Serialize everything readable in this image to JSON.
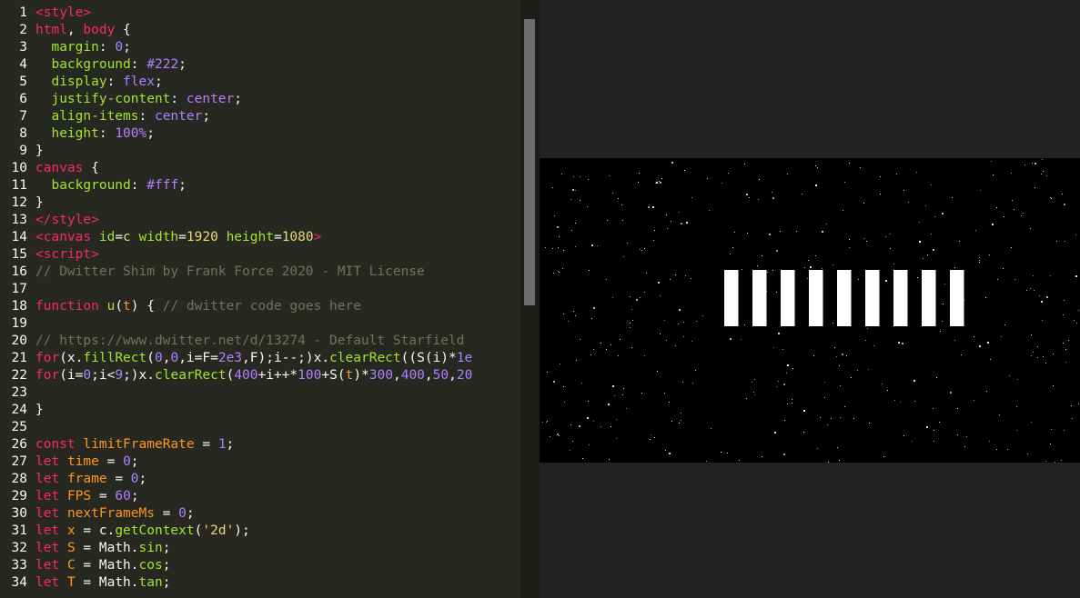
{
  "editor": {
    "lines": [
      {
        "n": "1",
        "t": [
          {
            "c": "t-tag",
            "s": "<style>"
          }
        ]
      },
      {
        "n": "2",
        "t": [
          {
            "c": "t-tag",
            "s": "html"
          },
          {
            "c": "t-plain",
            "s": ", "
          },
          {
            "c": "t-tag",
            "s": "body"
          },
          {
            "c": "t-plain",
            "s": " {"
          }
        ]
      },
      {
        "n": "3",
        "t": [
          {
            "c": "t-plain",
            "s": "  "
          },
          {
            "c": "t-prop",
            "s": "margin"
          },
          {
            "c": "t-plain",
            "s": ": "
          },
          {
            "c": "t-num",
            "s": "0"
          },
          {
            "c": "t-plain",
            "s": ";"
          }
        ]
      },
      {
        "n": "4",
        "t": [
          {
            "c": "t-plain",
            "s": "  "
          },
          {
            "c": "t-prop",
            "s": "background"
          },
          {
            "c": "t-plain",
            "s": ": "
          },
          {
            "c": "t-num",
            "s": "#222"
          },
          {
            "c": "t-plain",
            "s": ";"
          }
        ]
      },
      {
        "n": "5",
        "t": [
          {
            "c": "t-plain",
            "s": "  "
          },
          {
            "c": "t-prop",
            "s": "display"
          },
          {
            "c": "t-plain",
            "s": ": "
          },
          {
            "c": "t-num",
            "s": "flex"
          },
          {
            "c": "t-plain",
            "s": ";"
          }
        ]
      },
      {
        "n": "6",
        "t": [
          {
            "c": "t-plain",
            "s": "  "
          },
          {
            "c": "t-prop",
            "s": "justify-content"
          },
          {
            "c": "t-plain",
            "s": ": "
          },
          {
            "c": "t-num",
            "s": "center"
          },
          {
            "c": "t-plain",
            "s": ";"
          }
        ]
      },
      {
        "n": "7",
        "t": [
          {
            "c": "t-plain",
            "s": "  "
          },
          {
            "c": "t-prop",
            "s": "align-items"
          },
          {
            "c": "t-plain",
            "s": ": "
          },
          {
            "c": "t-num",
            "s": "center"
          },
          {
            "c": "t-plain",
            "s": ";"
          }
        ]
      },
      {
        "n": "8",
        "t": [
          {
            "c": "t-plain",
            "s": "  "
          },
          {
            "c": "t-prop",
            "s": "height"
          },
          {
            "c": "t-plain",
            "s": ": "
          },
          {
            "c": "t-num",
            "s": "100%"
          },
          {
            "c": "t-plain",
            "s": ";"
          }
        ]
      },
      {
        "n": "9",
        "t": [
          {
            "c": "t-plain",
            "s": "}"
          }
        ]
      },
      {
        "n": "10",
        "t": [
          {
            "c": "t-tag",
            "s": "canvas"
          },
          {
            "c": "t-plain",
            "s": " {"
          }
        ]
      },
      {
        "n": "11",
        "t": [
          {
            "c": "t-plain",
            "s": "  "
          },
          {
            "c": "t-prop",
            "s": "background"
          },
          {
            "c": "t-plain",
            "s": ": "
          },
          {
            "c": "t-num",
            "s": "#fff"
          },
          {
            "c": "t-plain",
            "s": ";"
          }
        ]
      },
      {
        "n": "12",
        "t": [
          {
            "c": "t-plain",
            "s": "}"
          }
        ]
      },
      {
        "n": "13",
        "t": [
          {
            "c": "t-tag",
            "s": "</style>"
          }
        ]
      },
      {
        "n": "14",
        "t": [
          {
            "c": "t-tag",
            "s": "<canvas "
          },
          {
            "c": "t-prop",
            "s": "id"
          },
          {
            "c": "t-plain",
            "s": "="
          },
          {
            "c": "t-str",
            "s": "c"
          },
          {
            "c": "t-plain",
            "s": " "
          },
          {
            "c": "t-prop",
            "s": "width"
          },
          {
            "c": "t-plain",
            "s": "="
          },
          {
            "c": "t-str",
            "s": "1920"
          },
          {
            "c": "t-plain",
            "s": " "
          },
          {
            "c": "t-prop",
            "s": "height"
          },
          {
            "c": "t-plain",
            "s": "="
          },
          {
            "c": "t-str",
            "s": "1080"
          },
          {
            "c": "t-tag",
            "s": ">"
          }
        ]
      },
      {
        "n": "15",
        "t": [
          {
            "c": "t-tag",
            "s": "<script>"
          }
        ]
      },
      {
        "n": "16",
        "t": [
          {
            "c": "t-com",
            "s": "// Dwitter Shim by Frank Force 2020 - MIT License"
          }
        ]
      },
      {
        "n": "17",
        "t": []
      },
      {
        "n": "18",
        "t": [
          {
            "c": "t-kw",
            "s": "function"
          },
          {
            "c": "t-plain",
            "s": " "
          },
          {
            "c": "t-fn",
            "s": "u"
          },
          {
            "c": "t-plain",
            "s": "("
          },
          {
            "c": "t-var",
            "s": "t"
          },
          {
            "c": "t-plain",
            "s": ") { "
          },
          {
            "c": "t-com",
            "s": "// dwitter code goes here"
          }
        ]
      },
      {
        "n": "19",
        "t": []
      },
      {
        "n": "20",
        "t": [
          {
            "c": "t-com",
            "s": "// https://www.dwitter.net/d/13274 - Default Starfield"
          }
        ]
      },
      {
        "n": "21",
        "t": [
          {
            "c": "t-kw",
            "s": "for"
          },
          {
            "c": "t-plain",
            "s": "(x."
          },
          {
            "c": "t-fn",
            "s": "fillRect"
          },
          {
            "c": "t-plain",
            "s": "("
          },
          {
            "c": "t-num",
            "s": "0"
          },
          {
            "c": "t-plain",
            "s": ","
          },
          {
            "c": "t-num",
            "s": "0"
          },
          {
            "c": "t-plain",
            "s": ",i=F="
          },
          {
            "c": "t-num",
            "s": "2e3"
          },
          {
            "c": "t-plain",
            "s": ",F);i--;)x."
          },
          {
            "c": "t-fn",
            "s": "clearRect"
          },
          {
            "c": "t-plain",
            "s": "((S(i)*"
          },
          {
            "c": "t-num",
            "s": "1e"
          }
        ]
      },
      {
        "n": "22",
        "t": [
          {
            "c": "t-kw",
            "s": "for"
          },
          {
            "c": "t-plain",
            "s": "(i="
          },
          {
            "c": "t-num",
            "s": "0"
          },
          {
            "c": "t-plain",
            "s": ";i<"
          },
          {
            "c": "t-num",
            "s": "9"
          },
          {
            "c": "t-plain",
            "s": ";)x."
          },
          {
            "c": "t-fn",
            "s": "clearRect"
          },
          {
            "c": "t-plain",
            "s": "("
          },
          {
            "c": "t-num",
            "s": "400"
          },
          {
            "c": "t-plain",
            "s": "+i++*"
          },
          {
            "c": "t-num",
            "s": "100"
          },
          {
            "c": "t-plain",
            "s": "+S("
          },
          {
            "c": "t-var",
            "s": "t"
          },
          {
            "c": "t-plain",
            "s": ")*"
          },
          {
            "c": "t-num",
            "s": "300"
          },
          {
            "c": "t-plain",
            "s": ","
          },
          {
            "c": "t-num",
            "s": "400"
          },
          {
            "c": "t-plain",
            "s": ","
          },
          {
            "c": "t-num",
            "s": "50"
          },
          {
            "c": "t-plain",
            "s": ","
          },
          {
            "c": "t-num",
            "s": "20"
          }
        ]
      },
      {
        "n": "23",
        "t": []
      },
      {
        "n": "24",
        "t": [
          {
            "c": "t-plain",
            "s": "}"
          }
        ]
      },
      {
        "n": "25",
        "t": []
      },
      {
        "n": "26",
        "t": [
          {
            "c": "t-kw",
            "s": "const"
          },
          {
            "c": "t-plain",
            "s": " "
          },
          {
            "c": "t-var",
            "s": "limitFrameRate"
          },
          {
            "c": "t-plain",
            "s": " = "
          },
          {
            "c": "t-num",
            "s": "1"
          },
          {
            "c": "t-plain",
            "s": ";"
          }
        ]
      },
      {
        "n": "27",
        "t": [
          {
            "c": "t-kw",
            "s": "let"
          },
          {
            "c": "t-plain",
            "s": " "
          },
          {
            "c": "t-var",
            "s": "time"
          },
          {
            "c": "t-plain",
            "s": " = "
          },
          {
            "c": "t-num",
            "s": "0"
          },
          {
            "c": "t-plain",
            "s": ";"
          }
        ]
      },
      {
        "n": "28",
        "t": [
          {
            "c": "t-kw",
            "s": "let"
          },
          {
            "c": "t-plain",
            "s": " "
          },
          {
            "c": "t-var",
            "s": "frame"
          },
          {
            "c": "t-plain",
            "s": " = "
          },
          {
            "c": "t-num",
            "s": "0"
          },
          {
            "c": "t-plain",
            "s": ";"
          }
        ]
      },
      {
        "n": "29",
        "t": [
          {
            "c": "t-kw",
            "s": "let"
          },
          {
            "c": "t-plain",
            "s": " "
          },
          {
            "c": "t-var",
            "s": "FPS"
          },
          {
            "c": "t-plain",
            "s": " = "
          },
          {
            "c": "t-num",
            "s": "60"
          },
          {
            "c": "t-plain",
            "s": ";"
          }
        ]
      },
      {
        "n": "30",
        "t": [
          {
            "c": "t-kw",
            "s": "let"
          },
          {
            "c": "t-plain",
            "s": " "
          },
          {
            "c": "t-var",
            "s": "nextFrameMs"
          },
          {
            "c": "t-plain",
            "s": " = "
          },
          {
            "c": "t-num",
            "s": "0"
          },
          {
            "c": "t-plain",
            "s": ";"
          }
        ]
      },
      {
        "n": "31",
        "t": [
          {
            "c": "t-kw",
            "s": "let"
          },
          {
            "c": "t-plain",
            "s": " "
          },
          {
            "c": "t-var",
            "s": "x"
          },
          {
            "c": "t-plain",
            "s": " = c."
          },
          {
            "c": "t-fn",
            "s": "getContext"
          },
          {
            "c": "t-plain",
            "s": "("
          },
          {
            "c": "t-str",
            "s": "'2d'"
          },
          {
            "c": "t-plain",
            "s": ");"
          }
        ]
      },
      {
        "n": "32",
        "t": [
          {
            "c": "t-kw",
            "s": "let"
          },
          {
            "c": "t-plain",
            "s": " "
          },
          {
            "c": "t-var",
            "s": "S"
          },
          {
            "c": "t-plain",
            "s": " = Math."
          },
          {
            "c": "t-fn",
            "s": "sin"
          },
          {
            "c": "t-plain",
            "s": ";"
          }
        ]
      },
      {
        "n": "33",
        "t": [
          {
            "c": "t-kw",
            "s": "let"
          },
          {
            "c": "t-plain",
            "s": " "
          },
          {
            "c": "t-var",
            "s": "C"
          },
          {
            "c": "t-plain",
            "s": " = Math."
          },
          {
            "c": "t-fn",
            "s": "cos"
          },
          {
            "c": "t-plain",
            "s": ";"
          }
        ]
      },
      {
        "n": "34",
        "t": [
          {
            "c": "t-kw",
            "s": "let"
          },
          {
            "c": "t-plain",
            "s": " "
          },
          {
            "c": "t-var",
            "s": "T"
          },
          {
            "c": "t-plain",
            "s": " = Math."
          },
          {
            "c": "t-fn",
            "s": "tan"
          },
          {
            "c": "t-plain",
            "s": ";"
          }
        ]
      }
    ]
  },
  "preview": {
    "canvas_background": "#000000",
    "star_color": "#ffffff",
    "bar_count": 9
  }
}
